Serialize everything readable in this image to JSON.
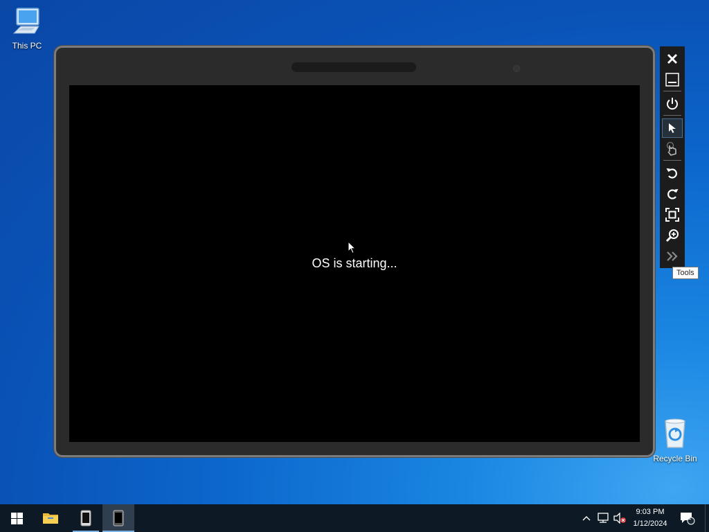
{
  "desktop": {
    "icons": [
      {
        "label": "This PC"
      },
      {
        "label": "Recycle Bin"
      }
    ]
  },
  "emulator": {
    "boot_message": "OS is starting..."
  },
  "toolbar": {
    "items": [
      {
        "icon": "close-icon"
      },
      {
        "icon": "minimize-icon"
      },
      {
        "icon": "power-icon"
      },
      {
        "icon": "pointer-icon",
        "selected": true
      },
      {
        "icon": "touch-icon"
      },
      {
        "icon": "rotate-left-icon"
      },
      {
        "icon": "rotate-right-icon"
      },
      {
        "icon": "fit-screen-icon"
      },
      {
        "icon": "zoom-icon"
      },
      {
        "icon": "tools-chevron-icon"
      }
    ],
    "tooltip": "Tools"
  },
  "taskbar": {
    "clock": {
      "time": "9:03 PM",
      "date": "1/12/2024"
    },
    "notification_count": "1",
    "accent_color": "#7cb3e6"
  }
}
